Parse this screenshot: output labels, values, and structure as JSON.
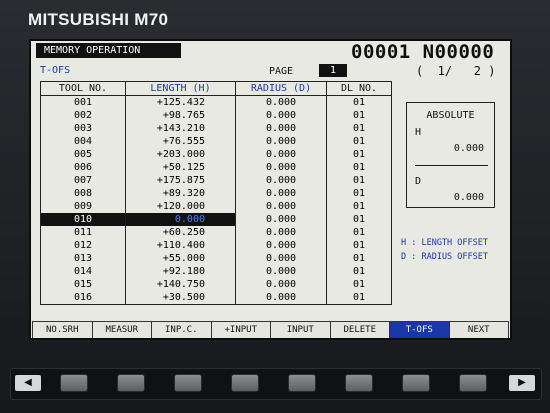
{
  "brand": "MITSUBISHI M70",
  "mode": "MEMORY OPERATION",
  "program": "00001  N00000",
  "screen_title": "T-OFS",
  "page": {
    "label": "PAGE",
    "value": "1",
    "count": "(  1/   2 )"
  },
  "table": {
    "headers": [
      "TOOL NO.",
      "LENGTH (H)",
      "RADIUS (D)",
      "DL NO."
    ],
    "rows": [
      [
        "001",
        "+125.432",
        "0.000",
        "01"
      ],
      [
        "002",
        "+98.765",
        "0.000",
        "01"
      ],
      [
        "003",
        "+143.210",
        "0.000",
        "01"
      ],
      [
        "004",
        "+76.555",
        "0.000",
        "01"
      ],
      [
        "005",
        "+203.000",
        "0.000",
        "01"
      ],
      [
        "006",
        "+50.125",
        "0.000",
        "01"
      ],
      [
        "007",
        "+175.875",
        "0.000",
        "01"
      ],
      [
        "008",
        "+89.320",
        "0.000",
        "01"
      ],
      [
        "009",
        "+120.000",
        "0.000",
        "01"
      ],
      [
        "010",
        "0.000",
        "0.000",
        "01"
      ],
      [
        "011",
        "+60.250",
        "0.000",
        "01"
      ],
      [
        "012",
        "+110.400",
        "0.000",
        "01"
      ],
      [
        "013",
        "+55.000",
        "0.000",
        "01"
      ],
      [
        "014",
        "+92.180",
        "0.000",
        "01"
      ],
      [
        "015",
        "+140.750",
        "0.000",
        "01"
      ],
      [
        "016",
        "+30.500",
        "0.000",
        "01"
      ]
    ],
    "selected_row": 9
  },
  "absolute": {
    "title": "ABSOLUTE",
    "h_label": "H",
    "h_value": "0.000",
    "d_label": "D",
    "d_value": "0.000"
  },
  "legend": [
    "H : LENGTH OFFSET",
    "D : RADIUS OFFSET"
  ],
  "softkeys": [
    "NO.SRH",
    "MEASUR",
    "INP.C.",
    "+INPUT",
    "INPUT",
    "DELETE",
    "T-OFS",
    "NEXT"
  ],
  "active_softkey": "T-OFS",
  "hardkeys": {
    "left_arrow": "◀",
    "right_arrow": "▶",
    "count": 8
  },
  "colors": {
    "screen_bg": "#e9e9e3",
    "accent_blue": "#1a37a8",
    "bezel": "#1c1e22"
  }
}
